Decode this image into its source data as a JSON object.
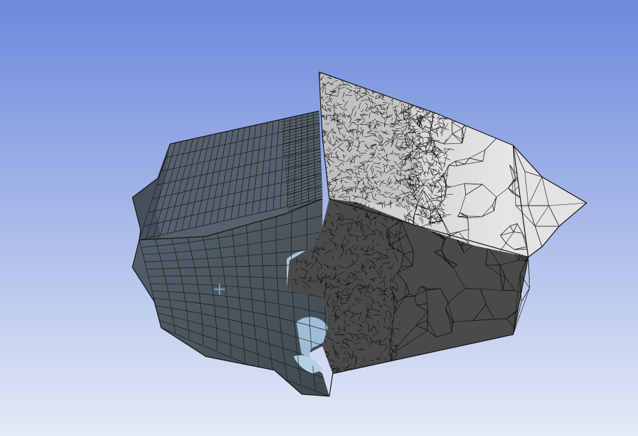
{
  "viewport": {
    "background_top_color": "#6c89dc",
    "background_bottom_color": "#e4eaf6"
  },
  "model": {
    "hex_region_color": "#4f5a64",
    "hex_region_dark_color": "#3d464e",
    "tooth_highlight_color": "#a9c6dd",
    "tet_top_color": "#d2d2d2",
    "tet_front_color": "#4a4a4a",
    "tet_side_color": "#e6e6e6",
    "mesh_line_color": "#111111"
  },
  "cursor": {
    "icon": "crosshair-icon",
    "color": "#9bbcf2"
  }
}
